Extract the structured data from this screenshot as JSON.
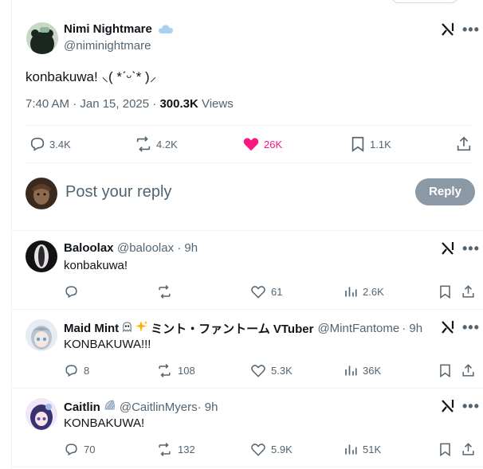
{
  "main_tweet": {
    "author_name": "Nimi Nightmare",
    "author_handle": "@niminightmare",
    "text": "konbakuwa! ⸜( *ˊᵕˋ* )⸝",
    "timestamp": "7:40 AM · Jan 15, 2025 · ",
    "views_count": "300.3K",
    "views_label": " Views",
    "stats": {
      "replies": "3.4K",
      "retweets": "4.2K",
      "likes": "26K",
      "bookmarks": "1.1K"
    },
    "like_color": "#f91880"
  },
  "reply_box": {
    "placeholder": "Post your reply",
    "button_label": "Reply"
  },
  "replies": [
    {
      "author_name": "Baloolax",
      "author_handle": "@baloolax",
      "time": " · 9h",
      "text": "konbakuwa!",
      "replies": "",
      "retweets": "",
      "likes": "61",
      "views": "2.6K"
    },
    {
      "author_name": "Maid Mint",
      "name_suffix": "ミント・ファントーム VTuber",
      "author_handle": "@MintFantome",
      "time": " · 9h",
      "text": "KONBAKUWA!!!",
      "replies": "8",
      "retweets": "108",
      "likes": "5.3K",
      "views": "36K"
    },
    {
      "author_name": "Caitlin",
      "author_handle": "@CaitlinMyers",
      "time": " · 9h",
      "text": "KONBAKUWA!",
      "replies": "70",
      "retweets": "132",
      "likes": "5.9K",
      "views": "51K"
    }
  ],
  "icons": {
    "more": "•••"
  }
}
